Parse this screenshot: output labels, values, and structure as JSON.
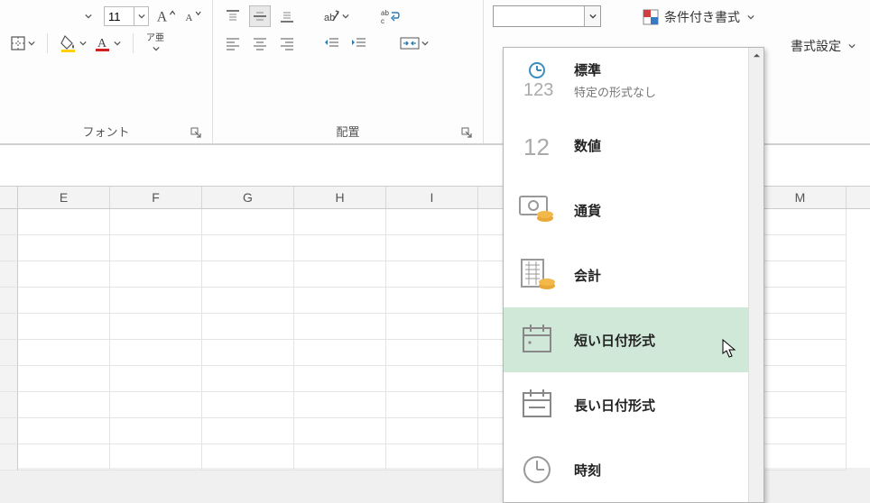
{
  "ribbon": {
    "font": {
      "size_value": "11",
      "grow_tip": "A↑",
      "shrink_tip": "A↓",
      "group_label": "フォント",
      "ruby_label": "ア亜"
    },
    "align": {
      "group_label": "配置"
    },
    "number": {
      "combo_value": ""
    },
    "styles": {
      "cond_format": "条件付き書式",
      "cell_style_partial": "書式設定"
    }
  },
  "dropdown": {
    "items": [
      {
        "icon": "clock-123",
        "title": "標準",
        "sub": "特定の形式なし",
        "selected": false
      },
      {
        "icon": "num-12",
        "title": "数値",
        "sub": "",
        "selected": false
      },
      {
        "icon": "currency",
        "title": "通貨",
        "sub": "",
        "selected": false
      },
      {
        "icon": "accounting",
        "title": "会計",
        "sub": "",
        "selected": false
      },
      {
        "icon": "short-date",
        "title": "短い日付形式",
        "sub": "",
        "selected": true
      },
      {
        "icon": "long-date",
        "title": "長い日付形式",
        "sub": "",
        "selected": false
      },
      {
        "icon": "time",
        "title": "時刻",
        "sub": "",
        "selected": false
      }
    ]
  },
  "columns": [
    "E",
    "F",
    "G",
    "H",
    "I",
    "",
    "",
    "",
    "M"
  ]
}
